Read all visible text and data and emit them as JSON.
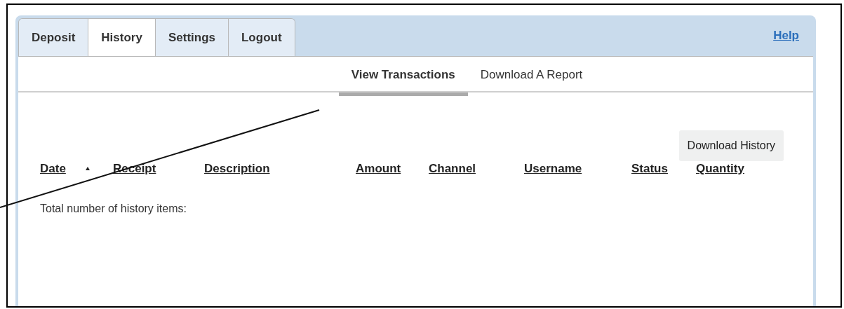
{
  "tabs": [
    {
      "label": "Deposit",
      "selected": false
    },
    {
      "label": "History",
      "selected": true
    },
    {
      "label": "Settings",
      "selected": false
    },
    {
      "label": "Logout",
      "selected": false
    }
  ],
  "help_link": "Help",
  "subtabs": [
    {
      "label": "View Transactions",
      "selected": true
    },
    {
      "label": "Download A Report",
      "selected": false
    }
  ],
  "download_button": "Download History",
  "table": {
    "columns": [
      {
        "label": "Date",
        "sorted": true
      },
      {
        "label": "Receipt",
        "sorted": false
      },
      {
        "label": "Description",
        "sorted": false
      },
      {
        "label": "Amount",
        "sorted": false
      },
      {
        "label": "Channel",
        "sorted": false
      },
      {
        "label": "Username",
        "sorted": false
      },
      {
        "label": "Status",
        "sorted": false
      },
      {
        "label": "Quantity",
        "sorted": false
      }
    ]
  },
  "total_label": "Total number of history items:"
}
